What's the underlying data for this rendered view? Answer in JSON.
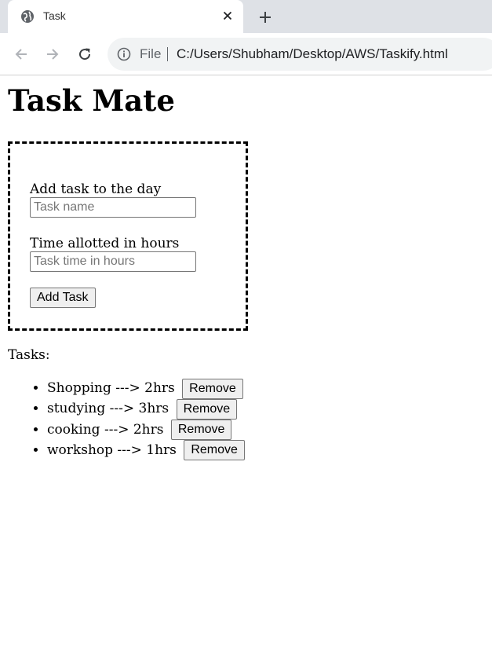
{
  "browser": {
    "tab_title": "Task",
    "address_scheme": "File",
    "address_url": "C:/Users/Shubham/Desktop/AWS/Taskify.html",
    "icons": {
      "favicon": "globe-icon",
      "tab_close": "close-icon",
      "new_tab": "plus-icon",
      "back": "back-arrow-icon",
      "forward": "forward-arrow-icon",
      "reload": "reload-icon",
      "site_info": "info-icon"
    }
  },
  "page": {
    "title": "Task Mate",
    "form": {
      "task_label": "Add task to the day",
      "task_placeholder": "Task name",
      "task_value": "",
      "time_label": "Time allotted in hours",
      "time_placeholder": "Task time in hours",
      "time_value": "",
      "add_button": "Add Task"
    },
    "tasks_heading": "Tasks:",
    "tasks": [
      {
        "text": "Shopping ---> 2hrs",
        "remove_label": "Remove"
      },
      {
        "text": "studying ---> 3hrs",
        "remove_label": "Remove"
      },
      {
        "text": "cooking ---> 2hrs",
        "remove_label": "Remove"
      },
      {
        "text": "workshop ---> 1hrs",
        "remove_label": "Remove"
      }
    ]
  },
  "colors": {
    "tabstrip_bg": "#dee1e6",
    "omnibox_bg": "#f1f3f4",
    "button_bg": "#efefef"
  }
}
